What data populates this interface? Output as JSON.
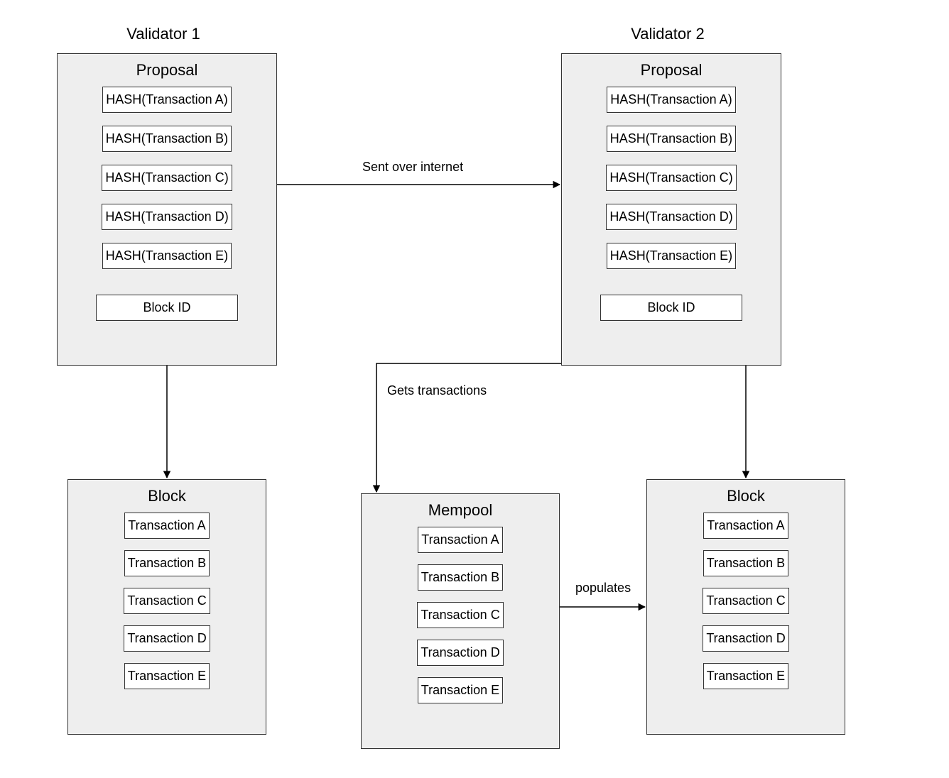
{
  "validators": {
    "left": {
      "title": "Validator 1"
    },
    "right": {
      "title": "Validator 2"
    }
  },
  "proposal": {
    "title": "Proposal",
    "hashes": [
      "HASH(Transaction A)",
      "HASH(Transaction B)",
      "HASH(Transaction C)",
      "HASH(Transaction D)",
      "HASH(Transaction E)"
    ],
    "block_id": "Block ID"
  },
  "block": {
    "title": "Block",
    "txs": [
      "Transaction A",
      "Transaction B",
      "Transaction C",
      "Transaction D",
      "Transaction E"
    ]
  },
  "mempool": {
    "title": "Mempool",
    "txs": [
      "Transaction A",
      "Transaction B",
      "Transaction C",
      "Transaction D",
      "Transaction E"
    ]
  },
  "edges": {
    "sent_over_internet": "Sent over internet",
    "gets_transactions": "Gets transactions",
    "populates": "populates"
  }
}
